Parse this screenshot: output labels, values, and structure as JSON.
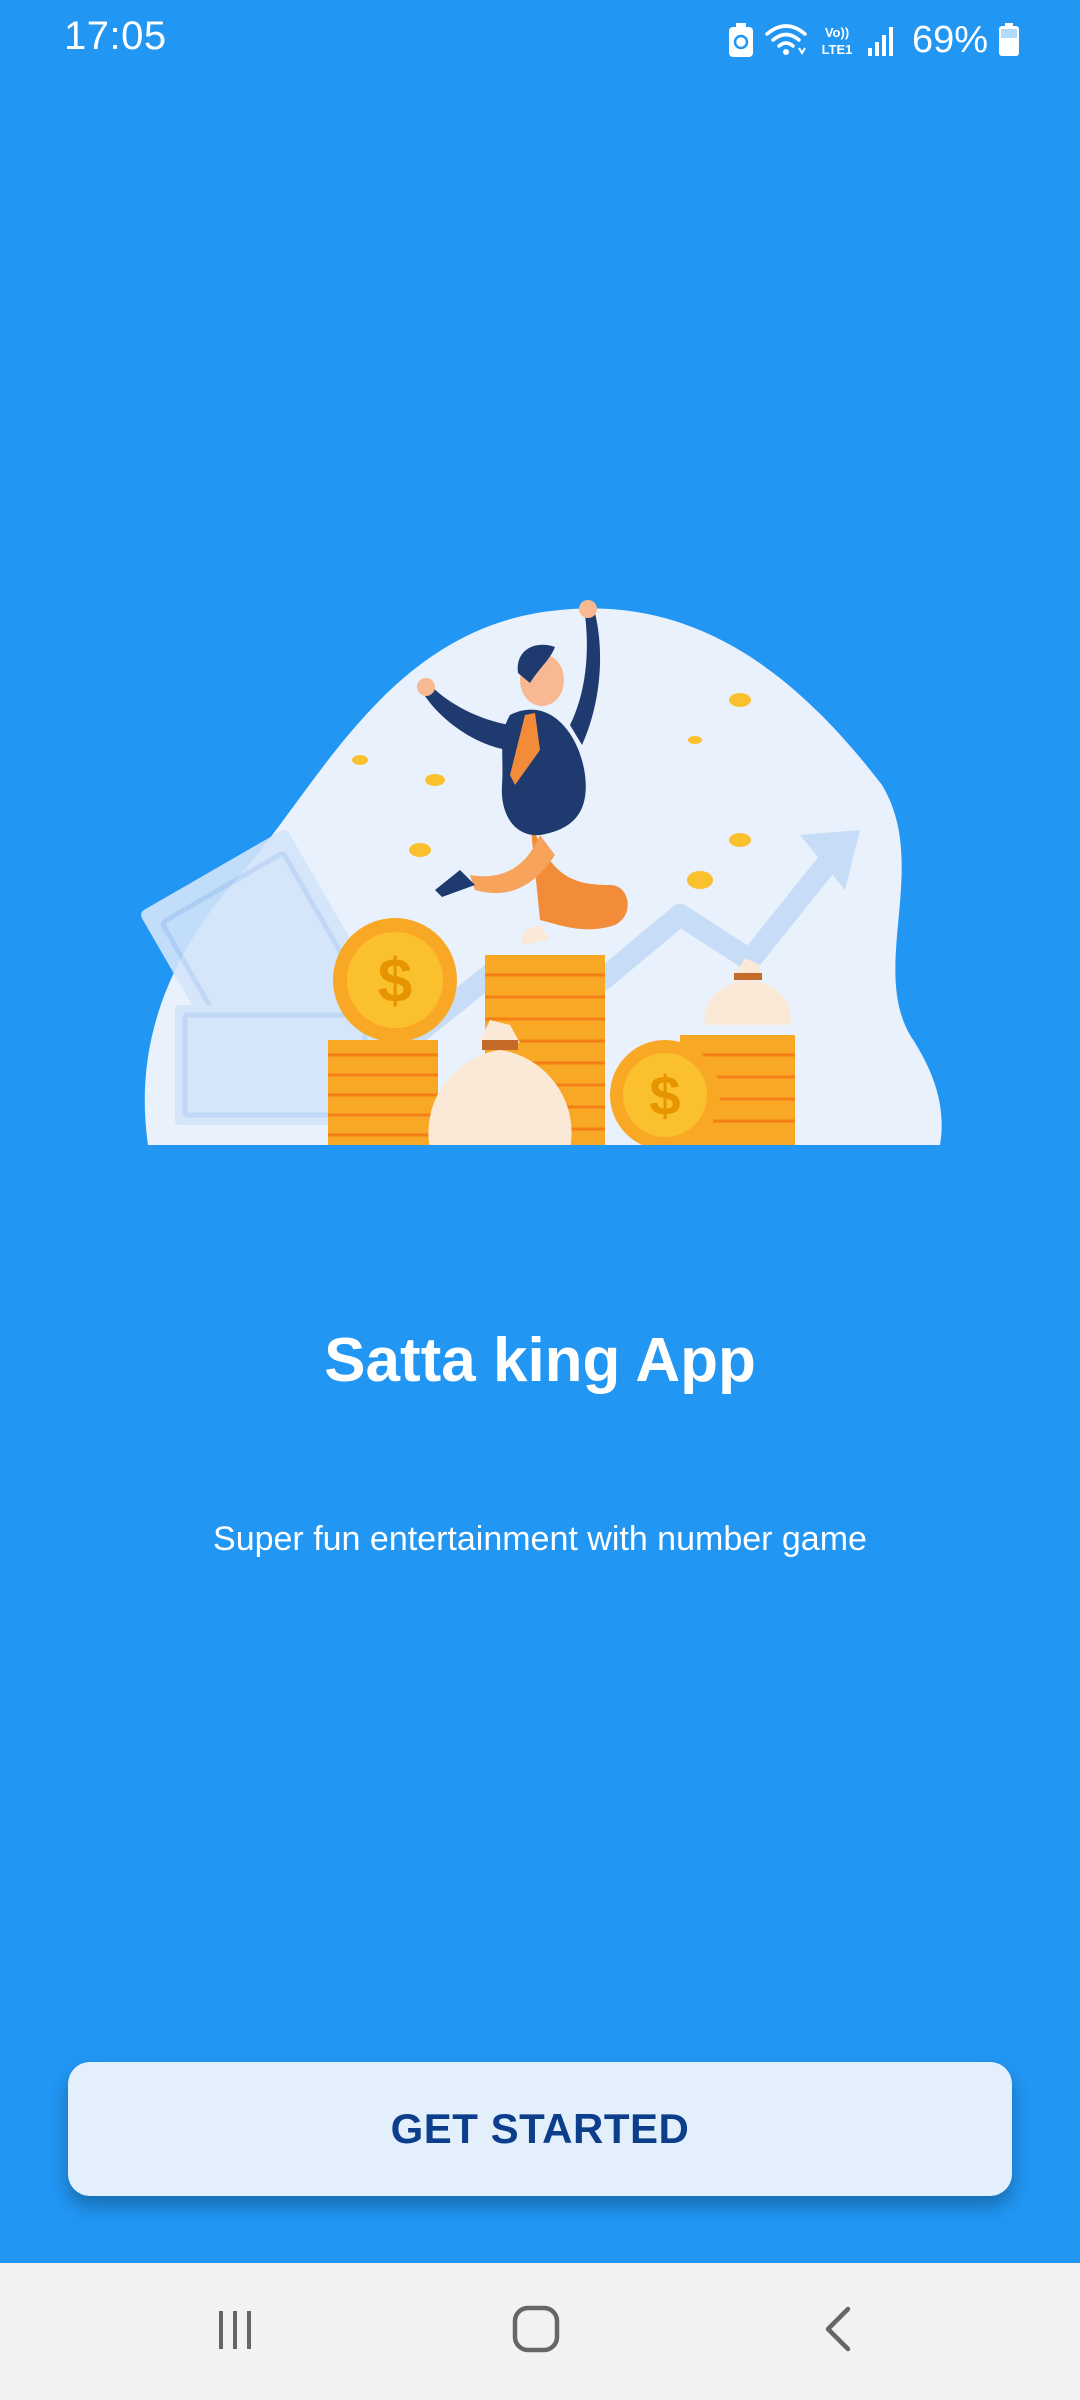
{
  "status_bar": {
    "time": "17:05",
    "battery_percent": "69%",
    "network_label": "VoLTE1",
    "icons": [
      "battery-saver-icon",
      "wifi-icon",
      "volte-icon",
      "signal-icon",
      "battery-icon"
    ]
  },
  "illustration": {
    "icon": "man-jumping-with-coins-illustration"
  },
  "content": {
    "title": "Satta king App",
    "subtitle": "Super fun entertainment with number game"
  },
  "actions": {
    "get_started_label": "GET STARTED"
  },
  "nav_bar": {
    "icons": [
      "recents-icon",
      "home-icon",
      "back-icon"
    ]
  },
  "colors": {
    "background": "#2196F3",
    "button_bg": "#E3F0FC",
    "button_text": "#0D3E8C",
    "nav_bg": "#F2F2F2"
  }
}
